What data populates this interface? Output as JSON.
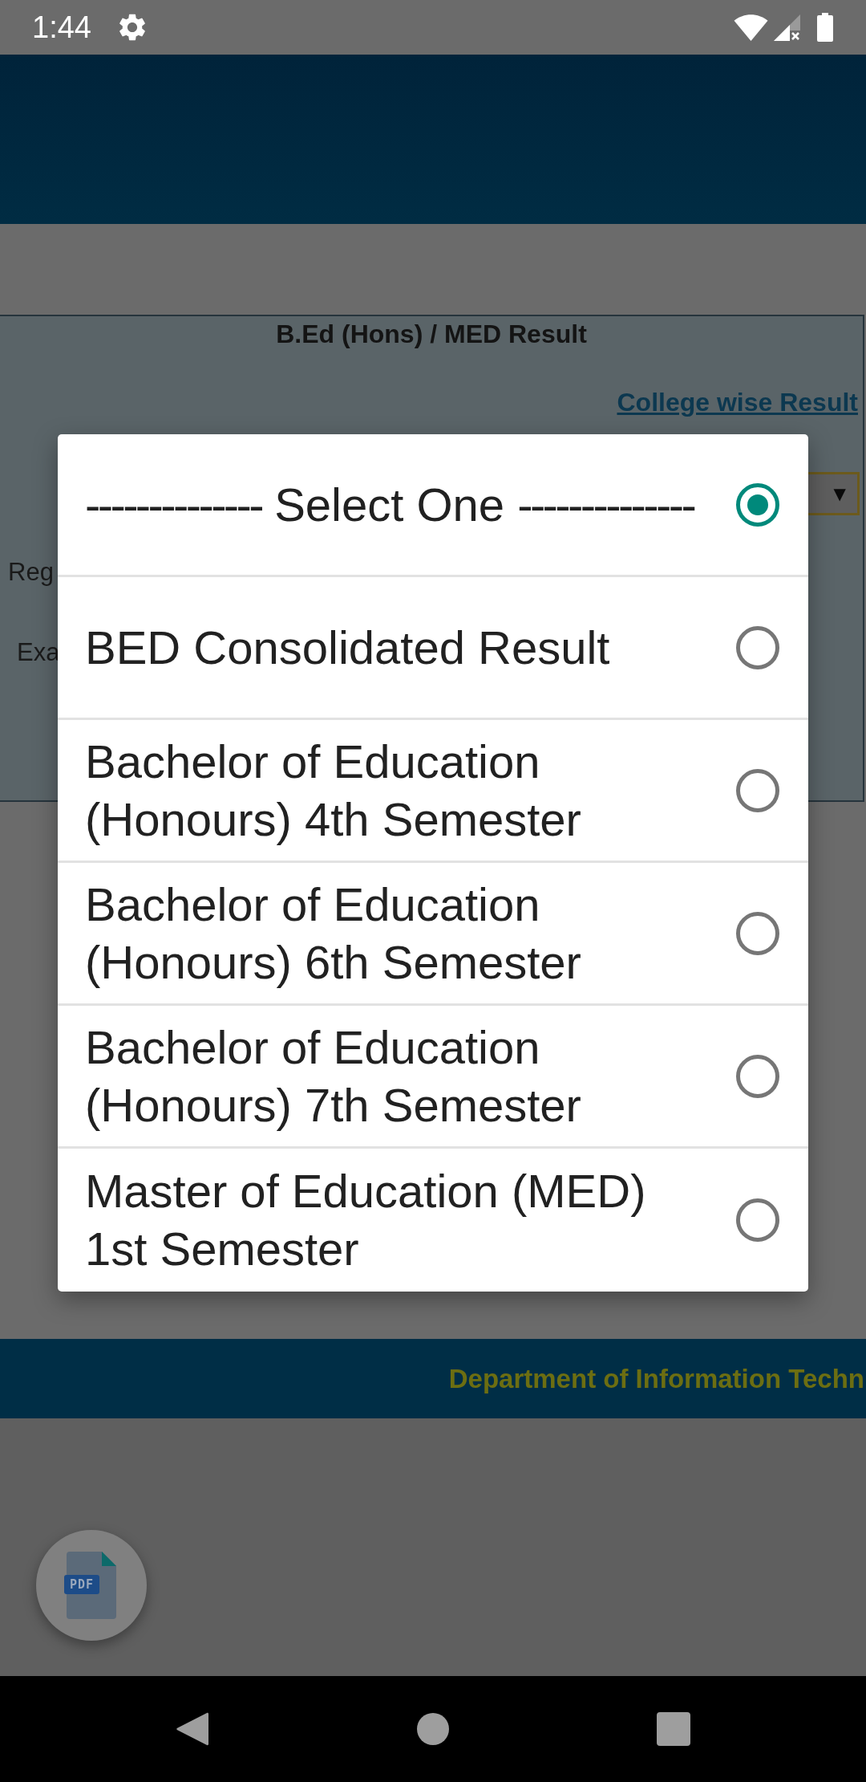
{
  "status_bar": {
    "time": "1:44"
  },
  "panel": {
    "title": "B.Ed (Hons) / MED Result",
    "link": "College wise Result",
    "select": {
      "arrow": "▼"
    },
    "field_labels": [
      "Reg",
      "Exa"
    ]
  },
  "dialog": {
    "options": [
      {
        "label": "-------------- Select One --------------",
        "selected": true
      },
      {
        "label": "BED Consolidated Result",
        "selected": false
      },
      {
        "label": "Bachelor of Education (Honours) 4th Semester",
        "selected": false
      },
      {
        "label": "Bachelor of Education (Honours) 6th Semester",
        "selected": false
      },
      {
        "label": "Bachelor of Education (Honours) 7th Semester",
        "selected": false
      },
      {
        "label": "Master of Education (MED) 1st Semester",
        "selected": false
      }
    ]
  },
  "footer": {
    "text": "Department of Information Techn"
  },
  "fab": {
    "badge": "PDF"
  }
}
